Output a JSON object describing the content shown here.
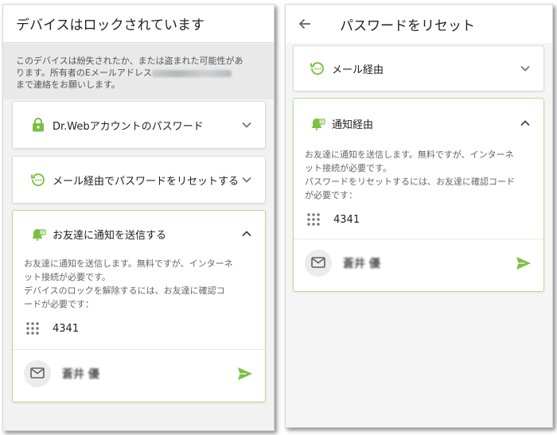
{
  "left": {
    "title": "デバイスはロックされています",
    "warning_line1": "このデバイスは紛失されたか、または盗まれた可能性があ",
    "warning_line2_prefix": "ります。所有者のEメールアドレス",
    "warning_line3": "まで連絡をお願いします。",
    "card_drweb_label": "Dr.Webアカウントのパスワード",
    "card_email_label": "メール経由でパスワードをリセットする",
    "card_friend_label": "お友達に通知を送信する",
    "friend_desc_line1": "お友達に通知を送信します。無料ですが、インターネ",
    "friend_desc_line2": "ット接続が必要です。",
    "friend_desc_line3": "デバイスのロックを解除するには、お友達に確認コ",
    "friend_desc_line4": "ードが必要です：",
    "code": "4341",
    "contact_name": "蒼井 優"
  },
  "right": {
    "title": "パスワードをリセット",
    "card_email_label": "メール経由",
    "card_notify_label": "通知経由",
    "desc_line1": "お友達に通知を送信します。無料ですが、インターネ",
    "desc_line2": "ット接続が必要です。",
    "desc_line3": "パスワードをリセットするには、お友達に確認コード",
    "desc_line4": "が必要です：",
    "code": "4341",
    "contact_name": "蒼井 優"
  },
  "colors": {
    "accent_green": "#7cc043",
    "open_border": "#b9dd8f",
    "icon_gray": "#757575"
  },
  "icons": [
    "lock-icon",
    "reset-icon",
    "notify-bell-icon",
    "chevron-down-icon",
    "chevron-up-icon",
    "dial-grid-icon",
    "mail-icon",
    "send-icon",
    "back-arrow-icon"
  ]
}
